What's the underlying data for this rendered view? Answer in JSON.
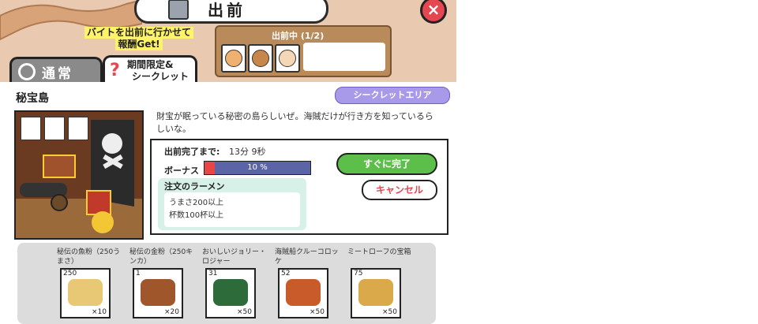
{
  "header": {
    "title": "出前",
    "icon": "fridge-icon"
  },
  "promo": {
    "line1": "バイトを出前に行かせて",
    "line2": "報酬Get!"
  },
  "status": {
    "label": "出前中",
    "count": "(1/2)"
  },
  "tabs": [
    {
      "label": "通常"
    },
    {
      "label1": "期間限定&",
      "label2": "シークレット"
    }
  ],
  "area": {
    "title": "秘宝島",
    "badge": "シークレットエリア"
  },
  "description": "財宝が眠っている秘密の島らしいぜ。海賊だけが行き方を知っているらしいな。",
  "order": {
    "time_label": "出前完了まで:",
    "time_value": "13分 9秒",
    "bonus_label": "ボーナス",
    "bonus_text": "10 %",
    "bonus_fraction": 0.1,
    "req_title": "注文のラーメン",
    "requirements": [
      "うまさ200以上",
      "杯数100杯以上"
    ],
    "now_label": "すぐに完了",
    "cancel_label": "キャンセル"
  },
  "ingredients": [
    {
      "name": "秘伝の魚粉（250うまさ）",
      "count": "250",
      "qty": "×10",
      "color": "#e8c775"
    },
    {
      "name": "秘伝の金粉（250キンカ）",
      "count": "1",
      "qty": "×20",
      "color": "#a0562b"
    },
    {
      "name": "おいしいジョリー・ロジャー",
      "count": "31",
      "qty": "×50",
      "color": "#2e6b3a"
    },
    {
      "name": "海賊船クルーコロッケ",
      "count": "52",
      "qty": "×50",
      "color": "#c95a2a"
    },
    {
      "name": "ミートローフの宝箱",
      "count": "75",
      "qty": "×50",
      "color": "#d9a94a"
    }
  ],
  "colors": {
    "accent_green": "#5cbf4a",
    "close_red": "#e64650",
    "secret_purple": "#a89ae8"
  }
}
